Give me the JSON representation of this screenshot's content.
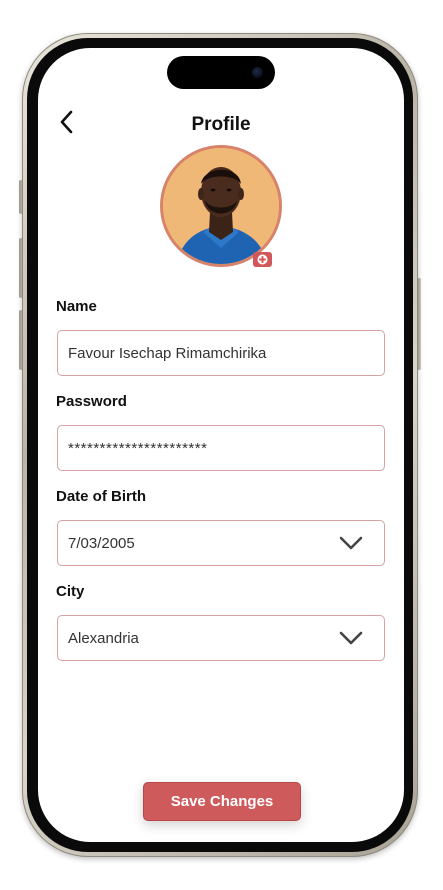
{
  "header": {
    "title": "Profile",
    "back_icon": "chevron-left-icon"
  },
  "avatar": {
    "badge_icon": "plus-icon",
    "badge_color": "#d2575a",
    "ring_color": "#d7826a",
    "background_color": "#f0b877"
  },
  "form": {
    "name": {
      "label": "Name",
      "value": "Favour Isechap Rimamchirika"
    },
    "password": {
      "label": "Password",
      "value": "**********************"
    },
    "date_of_birth": {
      "label": "Date of Birth",
      "value": "7/03/2005",
      "icon": "chevron-down-icon"
    },
    "city": {
      "label": "City",
      "value": "Alexandria",
      "icon": "chevron-down-icon"
    }
  },
  "actions": {
    "save_label": "Save Changes",
    "save_color": "#cf5a5c"
  },
  "colors": {
    "field_border": "#d7a3a3",
    "text_primary": "#111111"
  }
}
